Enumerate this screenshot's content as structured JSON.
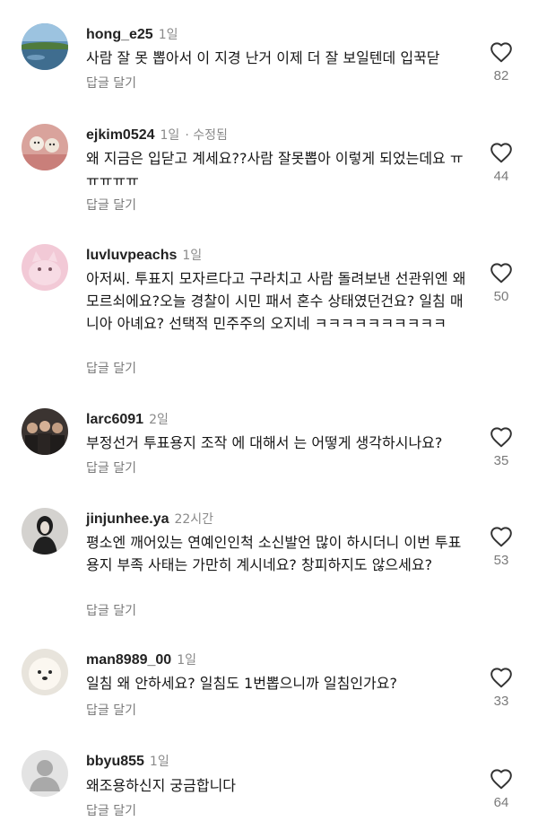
{
  "reply_label": "답글 달기",
  "colors": {
    "username": "#222222",
    "meta": "#8a8a8a",
    "text": "#161616",
    "like_outline": "#333333"
  },
  "comments": [
    {
      "username": "hong_e25",
      "time": "1일",
      "edited": "",
      "text": "사람 잘 못 뽑아서 이 지경 난거 이제 더 잘 보일텐데 입꾹닫",
      "likes": "82",
      "avatar_icon": "landscape-avatar-icon"
    },
    {
      "username": "ejkim0524",
      "time": "1일",
      "edited": "· 수정됨",
      "text": "왜 지금은 입닫고 계세요??사람 잘못뽑아 이렇게 되었는데요 ㅠㅠㅠㅠㅠ",
      "likes": "44",
      "avatar_icon": "dogs-avatar-icon"
    },
    {
      "username": "luvluvpeachs",
      "time": "1일",
      "edited": "",
      "text": "아저씨.  투표지 모자르다고 구라치고 사람 돌려보낸 선관위엔 왜 모르쇠에요?오늘 경찰이 시민 패서 혼수 상태였던건요? 일침 매니아 아녜요? 선택적 민주주의 오지네 ㅋㅋㅋㅋㅋㅋㅋㅋㅋㅋ",
      "likes": "50",
      "avatar_icon": "cat-avatar-icon"
    },
    {
      "username": "larc6091",
      "time": "2일",
      "edited": "",
      "text": "부정선거 투표용지 조작 에 대해서 는 어떻게 생각하시나요?",
      "likes": "35",
      "avatar_icon": "group-photo-avatar-icon"
    },
    {
      "username": "jinjunhee.ya",
      "time": "22시간",
      "edited": "",
      "text": "평소엔 깨어있는 연예인인척 소신발언 많이 하시더니 이번 투표 용지 부족 사태는 가만히 계시네요? 창피하지도 않으세요?",
      "likes": "53",
      "avatar_icon": "portrait-avatar-icon"
    },
    {
      "username": "man8989_00",
      "time": "1일",
      "edited": "",
      "text": "일침 왜 안하세요? 일침도 1번뽑으니까 일침인가요?",
      "likes": "33",
      "avatar_icon": "puppy-avatar-icon"
    },
    {
      "username": "bbyu855",
      "time": "1일",
      "edited": "",
      "text": "왜조용하신지 궁금합니다",
      "likes": "64",
      "avatar_icon": "default-user-avatar-icon"
    }
  ]
}
